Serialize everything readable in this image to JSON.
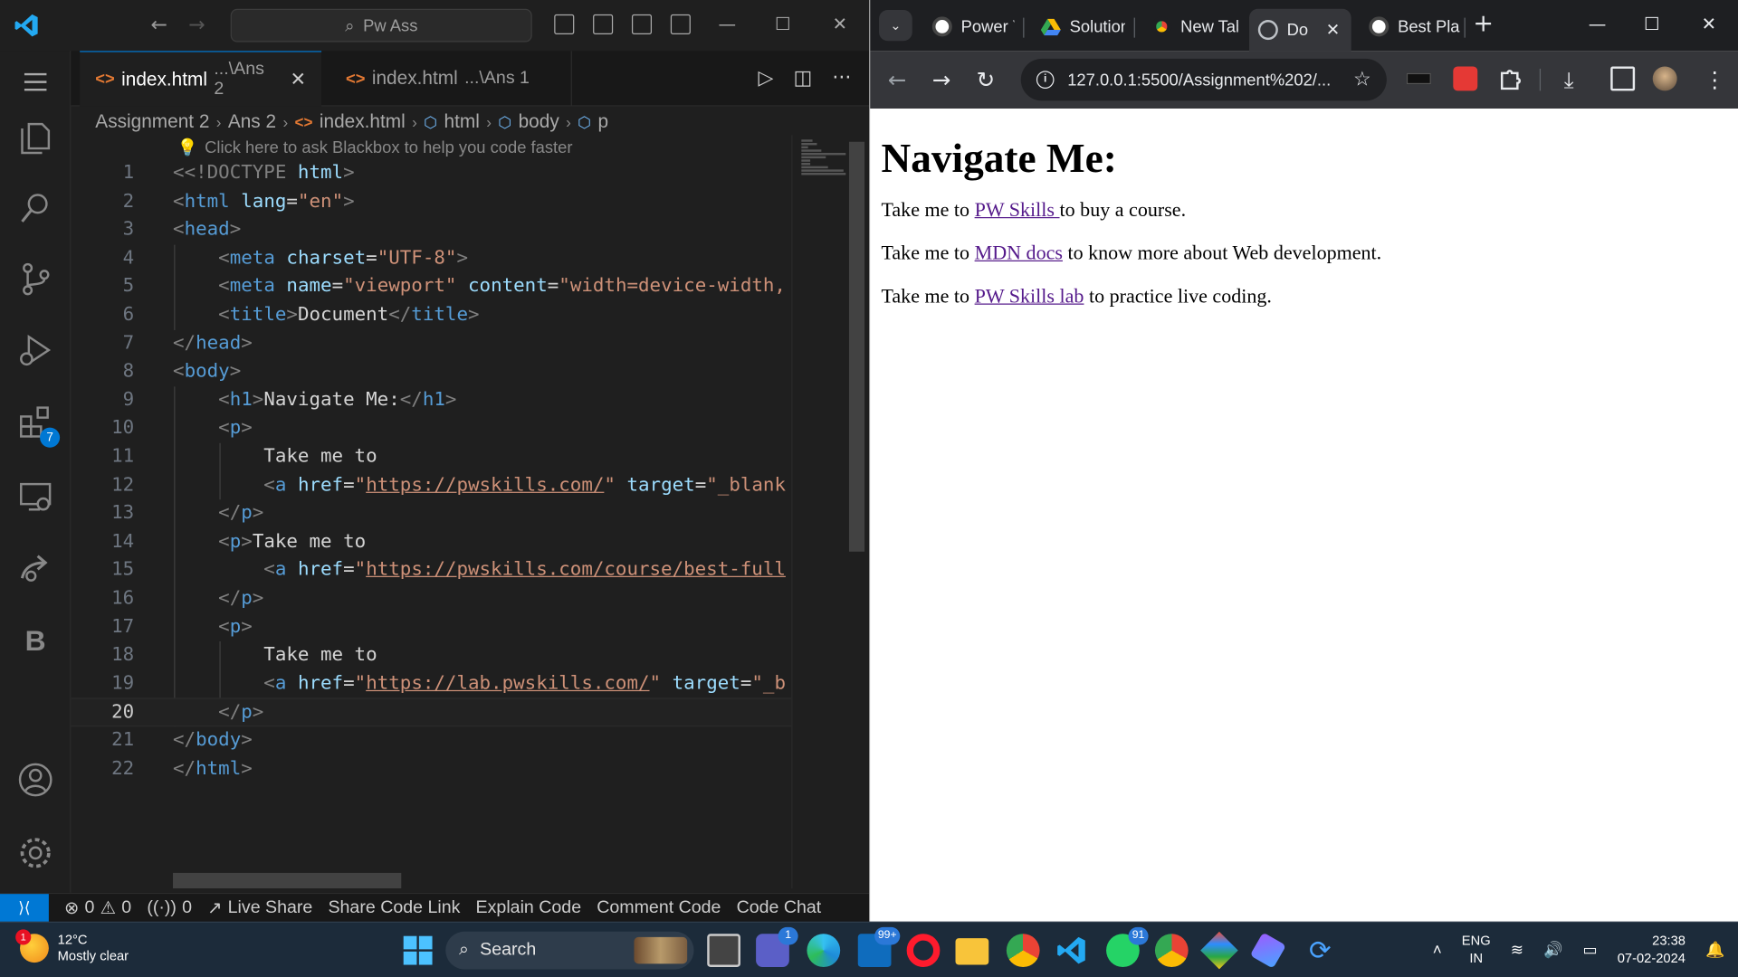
{
  "vscode": {
    "search_text": "Pw Ass",
    "tabs": [
      {
        "name": "index.html",
        "desc": "...\\Ans 2"
      },
      {
        "name": "index.html",
        "desc": "...\\Ans 1"
      }
    ],
    "breadcrumb": [
      "Assignment 2",
      "Ans 2",
      "index.html",
      "html",
      "body",
      "p"
    ],
    "hint": "Click here to ask Blackbox to help you code faster",
    "extensions_badge": "7",
    "line_numbers": [
      "1",
      "2",
      "3",
      "4",
      "5",
      "6",
      "7",
      "8",
      "9",
      "10",
      "11",
      "12",
      "13",
      "14",
      "15",
      "16",
      "17",
      "18",
      "19",
      "20",
      "21",
      "22"
    ],
    "code": {
      "l1_doctype": "<!DOCTYPE",
      "l1_html": "html",
      "l2_tag": "html",
      "l2_attr": "lang",
      "l2_val": "\"en\"",
      "l3_tag": "head",
      "l4_tag": "meta",
      "l4_attr": "charset",
      "l4_val": "\"UTF-8\"",
      "l5_tag": "meta",
      "l5_attr1": "name",
      "l5_val1": "\"viewport\"",
      "l5_attr2": "content",
      "l5_val2": "\"width=device-width,",
      "l6_tag": "title",
      "l6_text": "Document",
      "l7_tag": "head",
      "l8_tag": "body",
      "l9_tag": "h1",
      "l9_text": "Navigate Me:",
      "l10_tag": "p",
      "l11_text": "Take me to",
      "l12_tag": "a",
      "l12_attr": "href",
      "l12_val": "https://pwskills.com/",
      "l12_attr2": "target",
      "l12_val2": "\"_blank",
      "l13_tag": "p",
      "l14_tag": "p",
      "l14_text": "Take me to",
      "l15_tag": "a",
      "l15_attr": "href",
      "l15_val": "https://pwskills.com/course/best-full",
      "l16_tag": "p",
      "l17_tag": "p",
      "l18_text": "Take me to",
      "l19_tag": "a",
      "l19_attr": "href",
      "l19_val": "https://lab.pwskills.com/",
      "l19_attr2": "target",
      "l19_val2": "\"_b",
      "l20_tag": "p",
      "l21_tag": "body",
      "l22_tag": "html"
    },
    "status": {
      "errors": "0",
      "warnings": "0",
      "ports": "0",
      "live_share": "Live Share",
      "share_code": "Share Code Link",
      "explain_code": "Explain Code",
      "comment_code": "Comment Code",
      "code_chat": "Code Chat"
    }
  },
  "chrome": {
    "tabs": [
      {
        "title": "Power Y",
        "favicon": "wordpress"
      },
      {
        "title": "Solution",
        "favicon": "google-drive"
      },
      {
        "title": "New Tab",
        "favicon": "chrome"
      },
      {
        "title": "Do",
        "favicon": "globe"
      },
      {
        "title": "Best Pla",
        "favicon": "wordpress"
      }
    ],
    "url": "127.0.0.1:5500/Assignment%202/...",
    "page": {
      "heading": "Navigate Me:",
      "p1_pre": "Take me to ",
      "p1_link": "PW Skills ",
      "p1_post": "to buy a course.",
      "p2_pre": "Take me to ",
      "p2_link": "MDN docs",
      "p2_post": " to know more about Web development.",
      "p3_pre": "Take me to ",
      "p3_link": "PW Skills lab",
      "p3_post": " to practice live coding."
    }
  },
  "taskbar": {
    "weather_temp": "12°C",
    "weather_desc": "Mostly clear",
    "weather_badge": "1",
    "search_label": "Search",
    "teams_badge": "1",
    "mail_badge": "99+",
    "whatsapp_badge": "91",
    "lang_line1": "ENG",
    "lang_line2": "IN",
    "time": "23:38",
    "date": "07-02-2024"
  },
  "colors": {
    "vscode_accent": "#0078d4",
    "link_visited": "#551a8b",
    "taskbar_bg": "#1c2b3a"
  }
}
